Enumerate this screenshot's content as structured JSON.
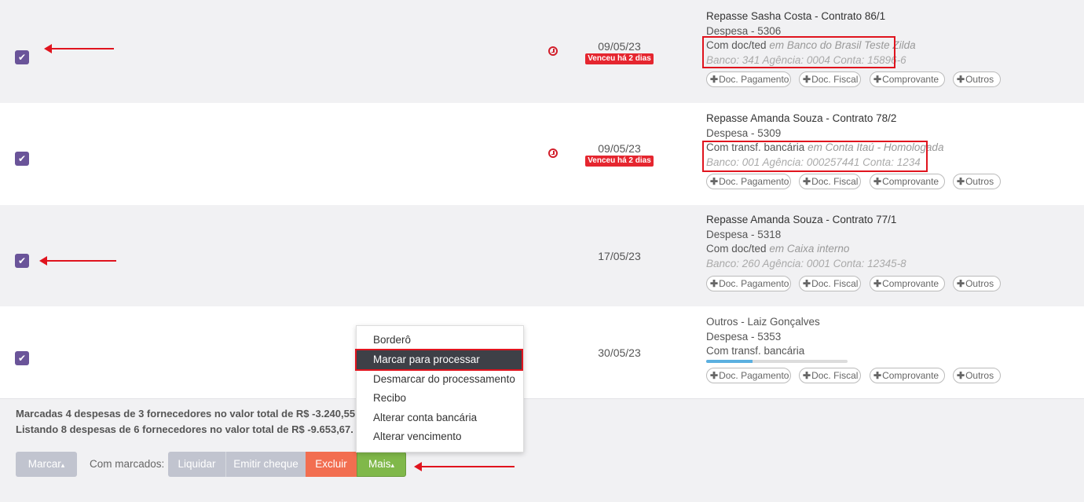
{
  "rows": [
    {
      "title": "Repasse Sasha Costa - Contrato 86/1",
      "despesa": "Despesa - 5306",
      "method": "Com doc/ted",
      "em": "em",
      "account": "Banco do Brasil Teste Zilda",
      "bank_line": "Banco: 341 Agência: 0004 Conta: 15896-6",
      "date": "09/05/23",
      "overdue": "Venceu há 2 dias"
    },
    {
      "title": "Repasse Amanda Souza - Contrato 78/2",
      "despesa": "Despesa - 5309",
      "method": "Com transf. bancária",
      "em": "em",
      "account": "Conta Itaú - Homologada",
      "bank_line": "Banco: 001 Agência: 000257441 Conta: 1234",
      "date": "09/05/23",
      "overdue": "Venceu há 2 dias"
    },
    {
      "title": "Repasse Amanda Souza - Contrato 77/1",
      "despesa": "Despesa - 5318",
      "method": "Com doc/ted",
      "em": "em",
      "account": "Caixa interno",
      "bank_line": "Banco: 260 Agência: 0001 Conta: 12345-8",
      "date": "17/05/23"
    },
    {
      "title": "Outros - Laiz Gonçalves",
      "despesa": "Despesa - 5353",
      "method": "Com transf. bancária",
      "date": "30/05/23",
      "progress": 0.33
    }
  ],
  "check_glyph": "✔",
  "plus_glyph": "✚",
  "tags": {
    "doc_pagamento": "Doc. Pagamento",
    "doc_fiscal": "Doc. Fiscal",
    "comprovante": "Comprovante",
    "outros": "Outros"
  },
  "summary": {
    "line1": "Marcadas 4 despesas de 3 fornecedores no valor total de R$ -3.240,55.",
    "line2": "Listando 8 despesas de 6 fornecedores no valor total de R$ -9.653,67."
  },
  "toolbar": {
    "marcar": "Marcar",
    "caret": "▴",
    "com_marcados": "Com marcados:",
    "liquidar": "Liquidar",
    "emitir_cheque": "Emitir cheque",
    "excluir": "Excluir",
    "mais": "Mais"
  },
  "menu": {
    "items": [
      "Borderô",
      "Marcar para processar",
      "Desmarcar do processamento",
      "Recibo",
      "Alterar conta bancária",
      "Alterar vencimento"
    ],
    "active_index": 1
  },
  "colors": {
    "checkbox": "#6a5499",
    "overdue": "#e5262f",
    "highlight": "#e0141e",
    "excluir": "#f26e50",
    "mais": "#80b84a",
    "button_gray": "#c1c4cf"
  }
}
